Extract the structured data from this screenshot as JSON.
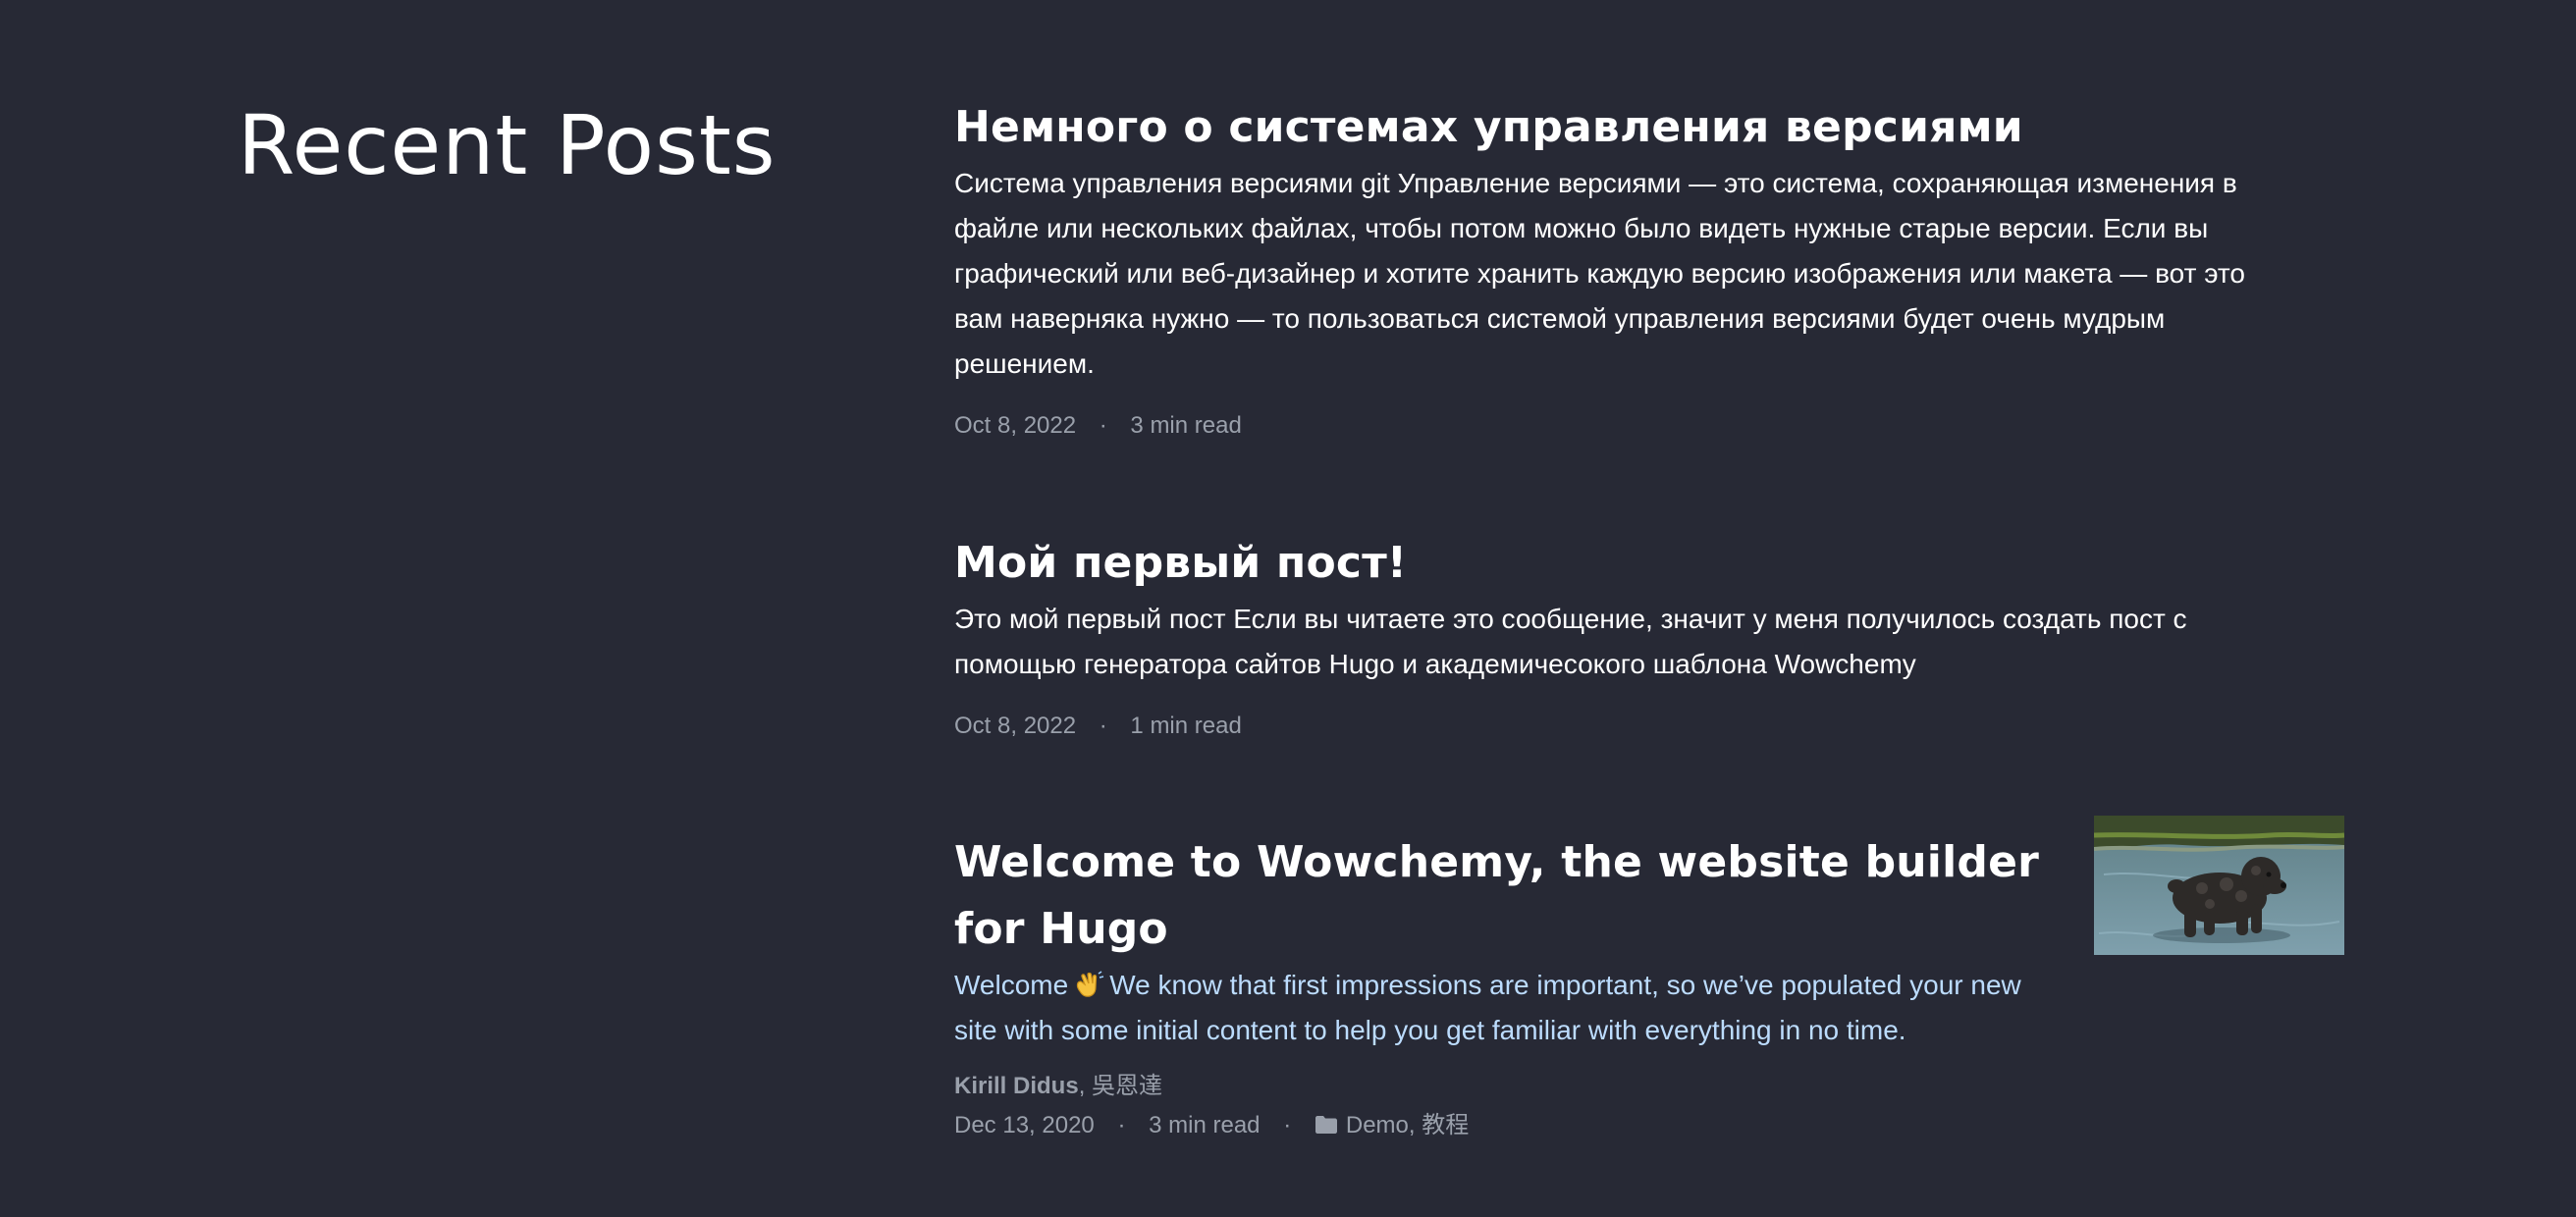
{
  "section": {
    "title": "Recent Posts"
  },
  "posts": [
    {
      "title": "Немного о системах управления версиями",
      "summary": "Система управления версиями git Управление версиями — это система, сохраняющая изменения в файле или нескольких файлах, чтобы потом можно было видеть нужные старые версии. Если вы графический или веб-дизайнер и хотите хранить каждую версию изображения или макета — вот это вам наверняка нужно — то пользоваться системой управления версиями будет очень мудрым решением.",
      "date": "Oct 8, 2022",
      "reading_time": "3 min read"
    },
    {
      "title": "Мой первый пост!",
      "summary": "Это мой первый пост Если вы читаете это сообщение, значит у меня получилось создать пост с помощью генератора сайтов Hugo и академичесокого шаблона Wowchemy",
      "date": "Oct 8, 2022",
      "reading_time": "1 min read"
    },
    {
      "title": "Welcome to Wowchemy, the website builder for Hugo",
      "summary_before_emoji": "Welcome",
      "summary_emoji": "waving-hand-icon",
      "summary_after_emoji": "We know that first impressions are important, so we’ve populated your new site with some initial content to help you get familiar with everything in no time.",
      "authors": [
        "Kirill Didus",
        "吳恩達"
      ],
      "author_separator": ",",
      "date": "Dec 13, 2020",
      "reading_time": "3 min read",
      "categories": [
        "Demo",
        "教程"
      ],
      "category_separator": ",",
      "meta_icon": "folder-icon",
      "thumbnail_icon": "dog-thumbnail-image"
    }
  ],
  "meta": {
    "separator": "·"
  },
  "colors": {
    "background": "#272935",
    "text": "#ffffff",
    "summary_link": "#bcdcfe",
    "meta": "#9aa0ab"
  }
}
